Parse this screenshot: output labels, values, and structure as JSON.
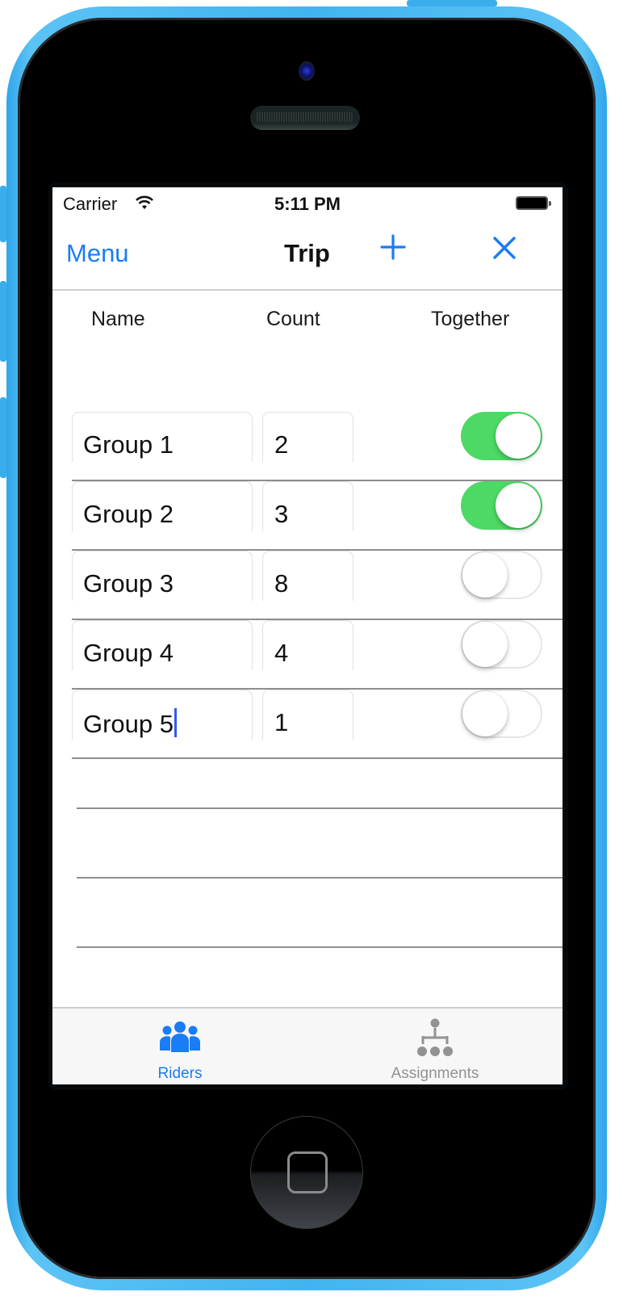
{
  "status_bar": {
    "carrier": "Carrier",
    "time": "5:11 PM",
    "wifi_icon": "wifi-icon",
    "battery_icon": "battery-full-icon"
  },
  "nav_bar": {
    "left_button": "Menu",
    "title": "Trip",
    "add_icon": "plus-icon",
    "close_icon": "close-x-icon"
  },
  "table": {
    "columns": [
      "Name",
      "Count",
      "Together"
    ],
    "rows": [
      {
        "name": "Group 1",
        "count": "2",
        "together": true
      },
      {
        "name": "Group 2",
        "count": "3",
        "together": true
      },
      {
        "name": "Group 3",
        "count": "8",
        "together": false
      },
      {
        "name": "Group 4",
        "count": "4",
        "together": false
      },
      {
        "name": "Group 5",
        "count": "1",
        "together": false,
        "editing": true
      }
    ],
    "empty_rows": 3
  },
  "tab_bar": {
    "tabs": [
      {
        "label": "Riders",
        "icon": "people-group-icon",
        "selected": true
      },
      {
        "label": "Assignments",
        "icon": "hierarchy-icon",
        "selected": false
      }
    ]
  },
  "colors": {
    "accent": "#1a7cf6",
    "toggle_on": "#4cd964",
    "tab_inactive": "#929292",
    "device_body": "#41b4ef"
  }
}
